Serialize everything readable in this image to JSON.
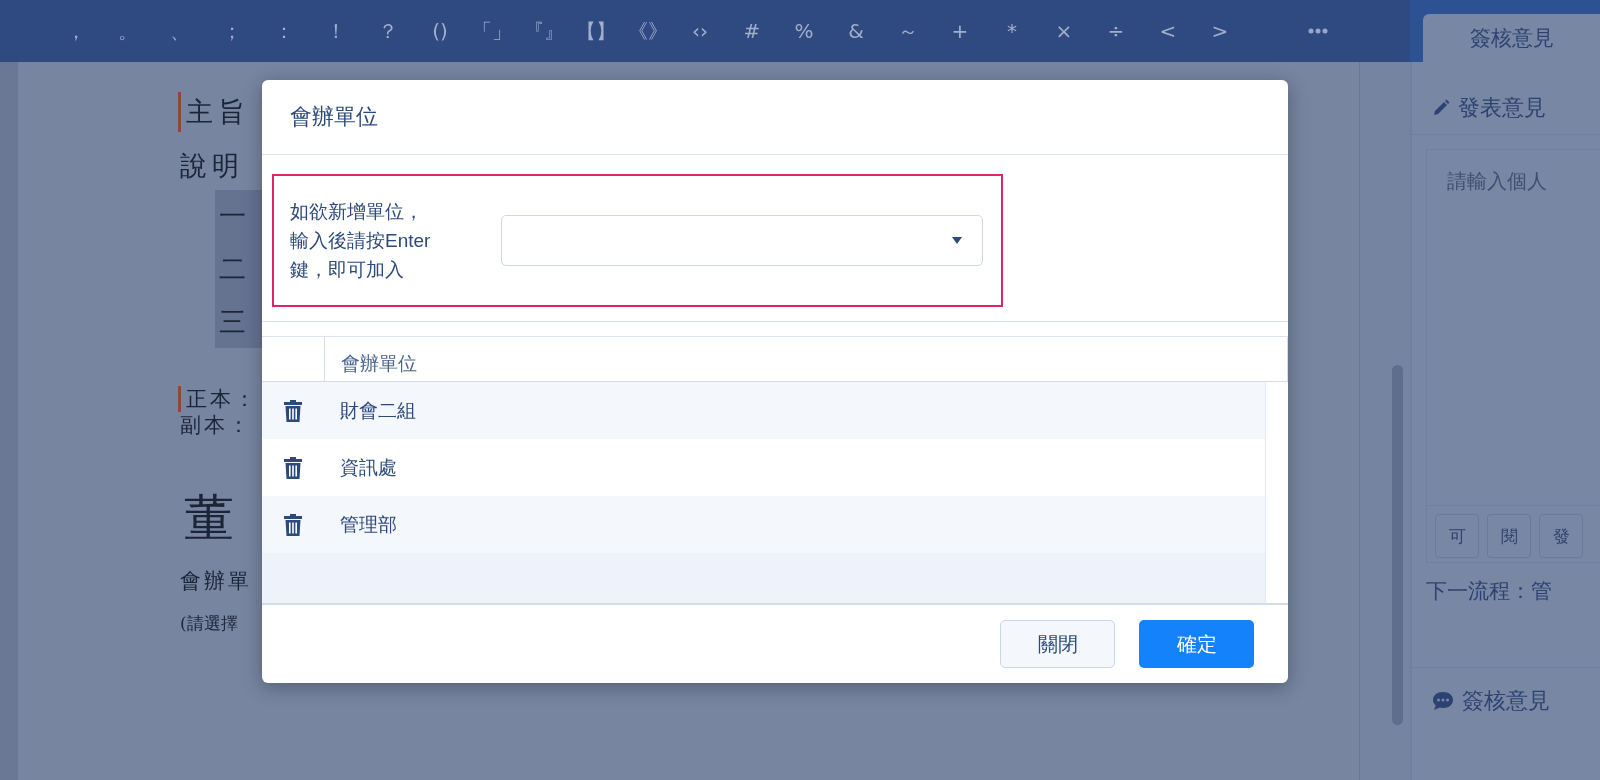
{
  "toolbar": {
    "symbols": [
      "，",
      "。",
      "、",
      "；",
      "：",
      "！",
      "？",
      "()",
      "「」",
      "『』",
      "【】",
      "《》",
      "‹›",
      "#",
      "%",
      "&",
      "～",
      "+",
      "*",
      "×",
      "÷",
      "<",
      ">"
    ]
  },
  "document": {
    "subject_label": "主旨",
    "description_label": "說明",
    "items": [
      "一",
      "二",
      "三"
    ],
    "original_copy": "正本：",
    "duplicate_copy": "副本：",
    "heading": "董",
    "note": "會辦單",
    "hint": "(請選擇"
  },
  "side_panel": {
    "tab": {
      "label": "簽核意見",
      "selected": true
    },
    "compose_title": "發表意見",
    "comment_placeholder": "請輸入個人",
    "quick_buttons": [
      "可",
      "閱",
      "發"
    ],
    "next_step": "下一流程：管",
    "comments_title": "簽核意見"
  },
  "dialog": {
    "title": "會辦單位",
    "add_hint_lines": [
      "如欲新增單位，",
      "輸入後請按Enter",
      "鍵，即可加入"
    ],
    "table": {
      "columns": [
        "會辦單位"
      ],
      "rows": [
        {
          "unit": "財會二組"
        },
        {
          "unit": "資訊處"
        },
        {
          "unit": "管理部"
        }
      ]
    },
    "buttons": [
      {
        "label": "關閉",
        "kind": "secondary"
      },
      {
        "label": "確定",
        "kind": "primary"
      }
    ]
  }
}
